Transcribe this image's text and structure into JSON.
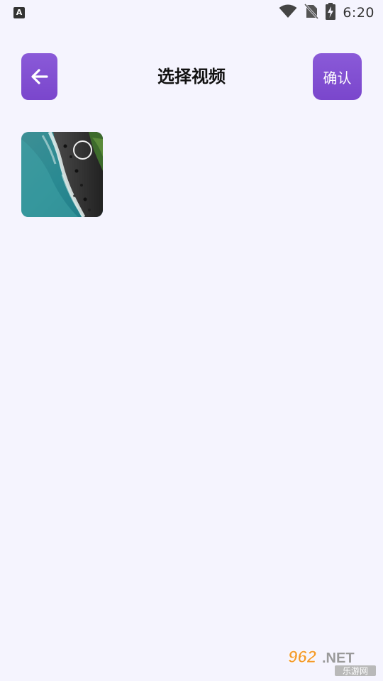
{
  "status_bar": {
    "notification_icon": "text-a-icon",
    "notification_letter": "A",
    "time": "6:20",
    "icons": [
      "wifi-icon",
      "no-sim-icon",
      "battery-charging-icon"
    ]
  },
  "header": {
    "back_icon": "arrow-left-icon",
    "title": "选择视频",
    "confirm_label": "确认"
  },
  "videos": [
    {
      "thumbnail": "aerial-coastline-thumbnail",
      "selected": false
    }
  ],
  "watermark": {
    "logo_text": "962.NET",
    "sub_text": "乐游网"
  },
  "colors": {
    "background": "#f5f4fe",
    "accent": "#7c4ccf",
    "title": "#111111"
  }
}
